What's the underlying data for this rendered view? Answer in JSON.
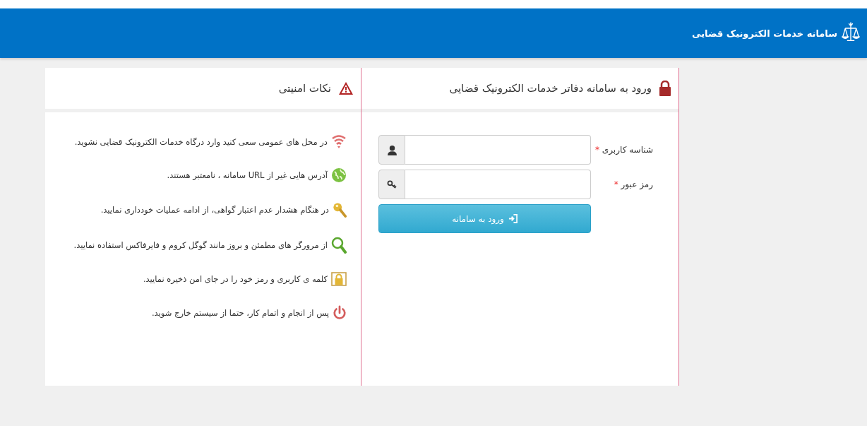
{
  "header": {
    "title": "سامانه خدمات الکترونیک قضایی"
  },
  "login": {
    "title": "ورود به سامانه دفاتر خدمات الکترونیک قضایی",
    "fields": [
      {
        "kind": "user",
        "label": "شناسه کاربری",
        "required_mark": "*"
      },
      {
        "kind": "password",
        "label": "رمز عبور",
        "required_mark": "*"
      }
    ],
    "submit": "ورود به سامانه"
  },
  "tips": {
    "title": "نکات امنیتی",
    "items": [
      {
        "kind": "wifi",
        "text": "در محل های عمومی سعی کنید وارد درگاه خدمات الکترونیک قضایی نشوید."
      },
      {
        "kind": "globe",
        "text": "آدرس هایی غیر از URL سامانه ، نامعتبر هستند."
      },
      {
        "kind": "key",
        "text": "در هنگام هشدار عدم اعتبار گواهی، از ادامه عملیات خودداری نمایید."
      },
      {
        "kind": "search",
        "text": "از مرورگر های مطمئن و بروز مانند گوگل کروم و فایرفاکس استفاده نمایید."
      },
      {
        "kind": "lock",
        "text": "کلمه ی کاربری و رمز خود را در جای امن ذخیره نمایید."
      },
      {
        "kind": "power",
        "text": "پس از انجام و اتمام کار، حتما از سیستم خارج شوید."
      }
    ]
  }
}
